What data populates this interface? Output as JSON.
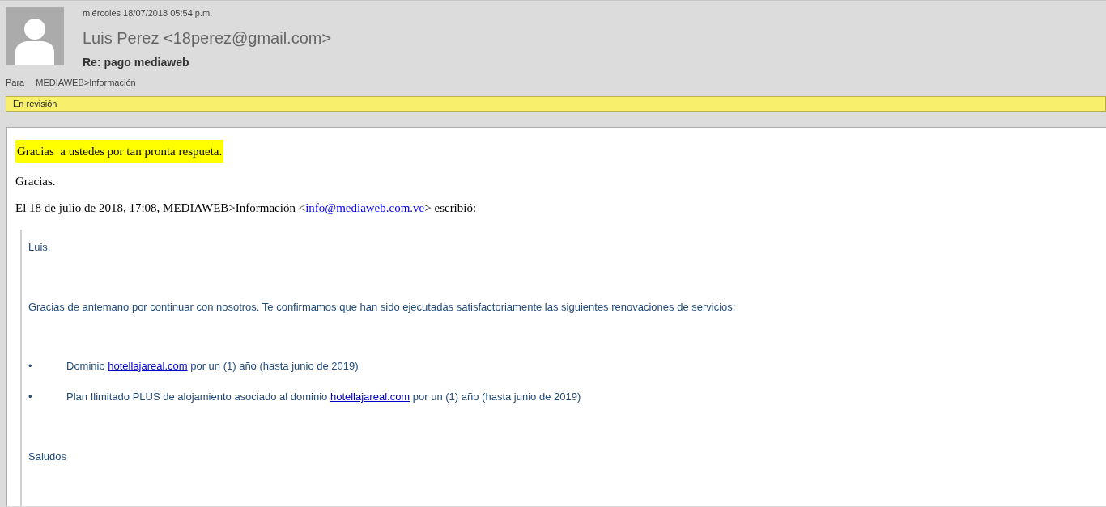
{
  "header": {
    "date": "miércoles 18/07/2018 05:54 p.m.",
    "sender": "Luis Perez <18perez@gmail.com>",
    "subject": "Re: pago mediaweb",
    "to_label": "Para",
    "to": "MEDIAWEB>Información",
    "flag": "En revisión"
  },
  "body": {
    "highlighted": "Gracias  a ustedes por tan pronta respueta.",
    "thanks": "Gracias.",
    "attribution": [
      {
        "kind": "text",
        "text": "El 18 de julio de 2018, 17:08, MEDIAWEB>Información <"
      },
      {
        "kind": "link",
        "text": "info@mediaweb.com.ve"
      },
      {
        "kind": "text",
        "text": "> escribió:"
      }
    ]
  },
  "quote": {
    "greeting": "Luis,",
    "intro": "Gracias de antemano por continuar con nosotros. Te confirmamos que han sido ejecutadas satisfactoriamente las siguientes renovaciones de servicios:",
    "items": [
      {
        "bullet": "•",
        "parts": [
          {
            "kind": "text",
            "text": "Dominio "
          },
          {
            "kind": "link",
            "text": "hotellajareal.com"
          },
          {
            "kind": "text",
            "text": " por un (1) año (hasta junio de 2019)"
          }
        ]
      },
      {
        "bullet": "•",
        "parts": [
          {
            "kind": "text",
            "text": "Plan Ilimitado PLUS de alojamiento asociado al dominio "
          },
          {
            "kind": "link",
            "text": "hotellajareal.com"
          },
          {
            "kind": "text",
            "text": " por un (1) año (hasta junio de 2019)"
          }
        ]
      }
    ],
    "closing": "Saludos"
  }
}
